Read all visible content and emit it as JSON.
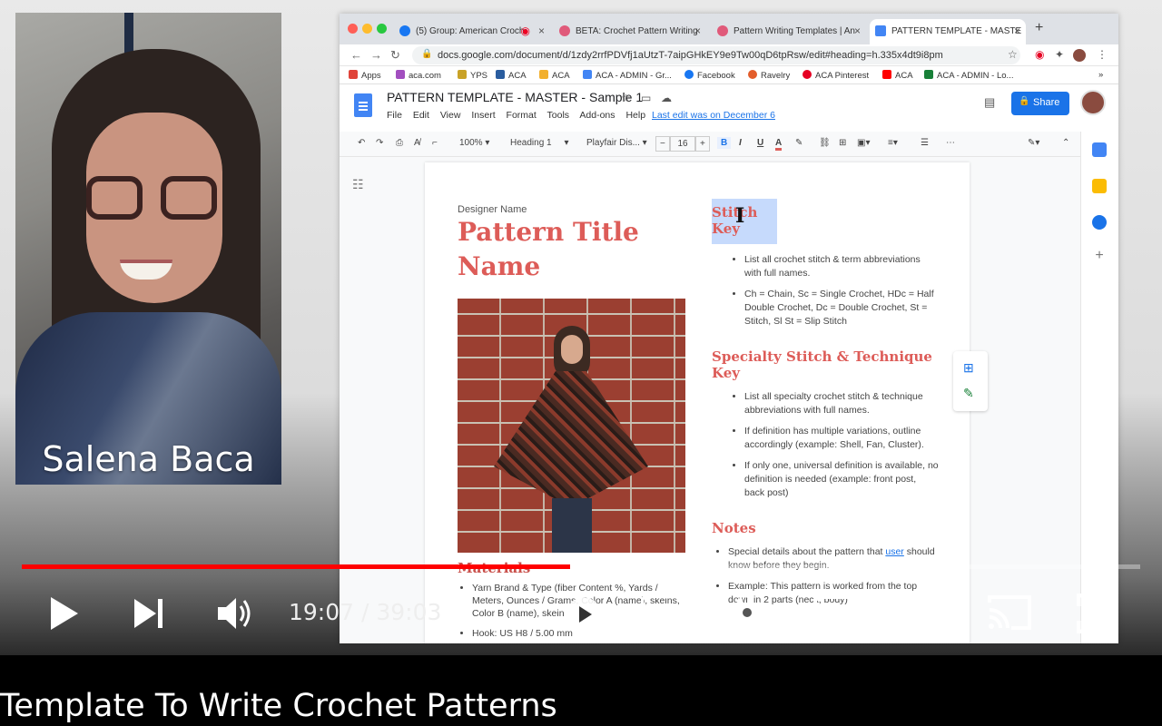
{
  "webcam": {
    "speaker_name": "Salena Baca"
  },
  "browser": {
    "tabs": [
      {
        "label": "(5) Group: American Croch",
        "icon_color": "#1877f2"
      },
      {
        "label": "BETA: Crochet Pattern Writing",
        "icon_color": "#e05a7a"
      },
      {
        "label": "Pattern Writing Templates | An",
        "icon_color": "#e05a7a"
      },
      {
        "label": "PATTERN TEMPLATE - MASTE",
        "icon_color": "#4285f4"
      }
    ],
    "url": "docs.google.com/document/d/1zdy2rrfPDVfj1aUtzT-7aipGHkEY9e9Tw00qD6tpRsw/edit#heading=h.335x4dt9i8pm",
    "bookmarks": [
      {
        "label": "Apps",
        "color": "#e0443a"
      },
      {
        "label": "aca.com",
        "color": "#a24fbf"
      },
      {
        "label": "YPS",
        "color": "#c9a227"
      },
      {
        "label": "ACA",
        "color": "#2a5d9f"
      },
      {
        "label": "ACA",
        "color": "#f2b02e"
      },
      {
        "label": "ACA - ADMIN - Gr...",
        "color": "#4285f4"
      },
      {
        "label": "Facebook",
        "color": "#1877f2"
      },
      {
        "label": "Ravelry",
        "color": "#e35d2b"
      },
      {
        "label": "ACA Pinterest",
        "color": "#e60023"
      },
      {
        "label": "ACA",
        "color": "#ff0000"
      },
      {
        "label": "ACA - ADMIN - Lo...",
        "color": "#188038"
      }
    ],
    "more_bookmarks": "»"
  },
  "docs": {
    "title": "PATTERN TEMPLATE - MASTER - Sample 1",
    "menus": [
      "File",
      "Edit",
      "View",
      "Insert",
      "Format",
      "Tools",
      "Add-ons",
      "Help"
    ],
    "last_edit": "Last edit was on December 6",
    "share_label": "Share",
    "toolbar": {
      "zoom": "100%",
      "style": "Heading 1",
      "font": "Playfair Dis...",
      "font_size": "16",
      "minus": "−",
      "plus": "+",
      "bold": "B",
      "italic": "I",
      "underline": "U",
      "text_color": "A"
    }
  },
  "document": {
    "designer_name": "Designer Name",
    "pattern_title": "Pattern Title Name",
    "materials_heading": "Materials",
    "materials": [
      "Yarn Brand & Type (fiber Content %, Yards / Meters, Ounces / Grams, Color A (name), skeins, Color B (name), skein",
      "Hook: US H8 / 5.00 mm"
    ],
    "stitch_key_heading": "Stitch Key",
    "stitch_key_items": [
      "List all crochet stitch & term abbreviations with full names.",
      "Ch = Chain, Sc = Single Crochet, HDc = Half Double Crochet, Dc = Double Crochet, St = Stitch, Sl St = Slip Stitch"
    ],
    "specialty_heading": "Specialty Stitch & Technique Key",
    "specialty_items": [
      "List all specialty crochet stitch & technique abbreviations with full names.",
      "If definition has multiple variations, outline accordingly (example: Shell, Fan, Cluster).",
      "If only one, universal  definition is available, no definition is needed (example: front post, back post)"
    ],
    "notes_heading": "Notes",
    "notes_items": [
      "Special details about the pattern that user should know before they begin.",
      "Example: This pattern is worked from the top down in 2 parts (neck, body)"
    ],
    "notes_underlined_word": "user"
  },
  "player": {
    "current_time": "19:07",
    "duration": "39:03",
    "time_display": "19:07 / 39:03",
    "progress_fraction": 0.49,
    "buffer_fraction": 0.503,
    "cc_label": "CC",
    "progress_color": "#ff0000"
  },
  "video_title": "Template To Write Crochet Patterns"
}
